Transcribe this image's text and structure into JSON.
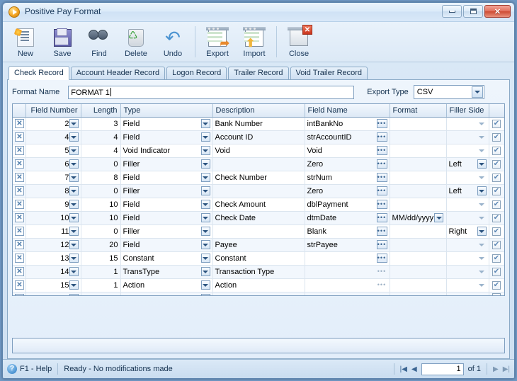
{
  "window": {
    "title": "Positive Pay Format",
    "icon": "play-circle-icon",
    "controls": {
      "minimize": "minimize-icon",
      "maximize": "maximize-icon",
      "close": "close-icon"
    }
  },
  "toolbar": {
    "buttons": [
      {
        "label": "New",
        "icon": "new-document-icon"
      },
      {
        "label": "Save",
        "icon": "floppy-disk-icon"
      },
      {
        "label": "Find",
        "icon": "binoculars-icon"
      },
      {
        "label": "Delete",
        "icon": "recycle-bin-icon"
      },
      {
        "label": "Undo",
        "icon": "undo-arrow-icon"
      },
      {
        "label": "Export",
        "icon": "export-grid-icon"
      },
      {
        "label": "Import",
        "icon": "import-grid-icon"
      },
      {
        "label": "Close",
        "icon": "close-window-icon"
      }
    ]
  },
  "tabs": [
    {
      "label": "Check Record",
      "active": true
    },
    {
      "label": "Account Header Record",
      "active": false
    },
    {
      "label": "Logon Record",
      "active": false
    },
    {
      "label": "Trailer Record",
      "active": false
    },
    {
      "label": "Void Trailer Record",
      "active": false
    }
  ],
  "form": {
    "format_name_label": "Format Name",
    "format_name_value": "FORMAT 1",
    "export_type_label": "Export Type",
    "export_type_value": "CSV"
  },
  "grid": {
    "columns": [
      "Field Number",
      "Length",
      "Type",
      "Description",
      "Field Name",
      "Format",
      "Filler Side",
      ""
    ],
    "rows": [
      {
        "field_number": "2",
        "length": "3",
        "type": "Field",
        "description": "Bank Number",
        "field_name": "intBankNo",
        "format": "",
        "filler_side": "",
        "checked": true,
        "dots_enabled": true
      },
      {
        "field_number": "4",
        "length": "4",
        "type": "Field",
        "description": "Account ID",
        "field_name": "strAccountID",
        "format": "",
        "filler_side": "",
        "checked": true,
        "dots_enabled": true
      },
      {
        "field_number": "5",
        "length": "4",
        "type": "Void Indicator",
        "description": "Void",
        "field_name": "Void",
        "format": "",
        "filler_side": "",
        "checked": true,
        "dots_enabled": true
      },
      {
        "field_number": "6",
        "length": "0",
        "type": "Filler",
        "description": "",
        "field_name": "Zero",
        "format": "",
        "filler_side": "Left",
        "checked": true,
        "dots_enabled": true
      },
      {
        "field_number": "7",
        "length": "8",
        "type": "Field",
        "description": "Check Number",
        "field_name": "strNum",
        "format": "",
        "filler_side": "",
        "checked": true,
        "dots_enabled": true
      },
      {
        "field_number": "8",
        "length": "0",
        "type": "Filler",
        "description": "",
        "field_name": "Zero",
        "format": "",
        "filler_side": "Left",
        "checked": true,
        "dots_enabled": true
      },
      {
        "field_number": "9",
        "length": "10",
        "type": "Field",
        "description": "Check Amount",
        "field_name": "dblPayment",
        "format": "",
        "filler_side": "",
        "checked": true,
        "dots_enabled": true
      },
      {
        "field_number": "10",
        "length": "10",
        "type": "Field",
        "description": "Check Date",
        "field_name": "dtmDate",
        "format": "MM/dd/yyyy",
        "filler_side": "",
        "checked": true,
        "dots_enabled": true
      },
      {
        "field_number": "11",
        "length": "0",
        "type": "Filler",
        "description": "",
        "field_name": "Blank",
        "format": "",
        "filler_side": "Right",
        "checked": true,
        "dots_enabled": true
      },
      {
        "field_number": "12",
        "length": "20",
        "type": "Field",
        "description": "Payee",
        "field_name": "strPayee",
        "format": "",
        "filler_side": "",
        "checked": true,
        "dots_enabled": true
      },
      {
        "field_number": "13",
        "length": "15",
        "type": "Constant",
        "description": "Constant",
        "field_name": "",
        "format": "",
        "filler_side": "",
        "checked": true,
        "dots_enabled": true
      },
      {
        "field_number": "14",
        "length": "1",
        "type": "TransType",
        "description": "Transaction Type",
        "field_name": "",
        "format": "",
        "filler_side": "",
        "checked": true,
        "dots_enabled": false
      },
      {
        "field_number": "15",
        "length": "1",
        "type": "Action",
        "description": "Action",
        "field_name": "",
        "format": "",
        "filler_side": "",
        "checked": true,
        "dots_enabled": false
      },
      {
        "field_number": "",
        "length": "",
        "type": "",
        "description": "",
        "field_name": "",
        "format": "",
        "filler_side": "",
        "checked": false,
        "dots_enabled": false
      }
    ],
    "row_delete_icon": "delete-row-icon"
  },
  "statusbar": {
    "help_icon": "help-icon",
    "help_label": "F1 - Help",
    "status_text": "Ready - No modifications made",
    "nav": {
      "first_icon": "first-page-icon",
      "prev_icon": "previous-page-icon",
      "page_value": "1",
      "of_label": "of 1",
      "next_icon": "next-page-icon",
      "last_icon": "last-page-icon"
    }
  }
}
